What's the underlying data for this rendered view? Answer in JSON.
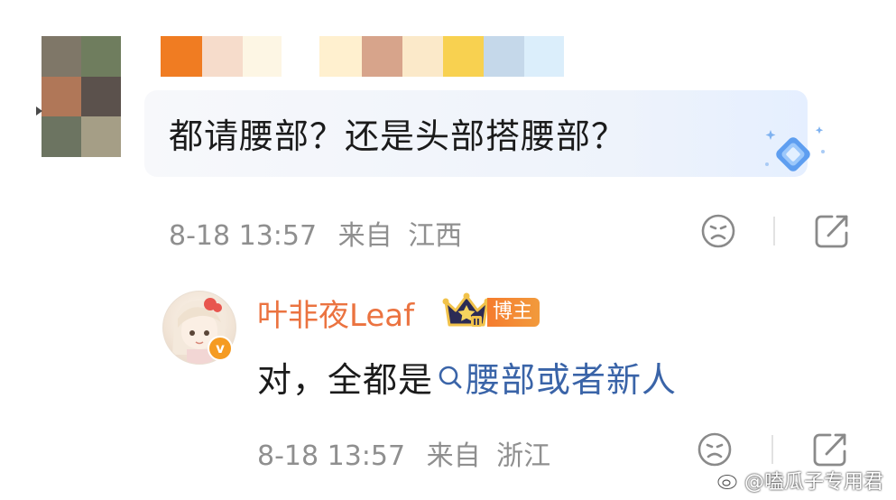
{
  "comment": {
    "mosaic_colors": [
      "#7f7768",
      "#6f7d5e",
      "#b07758",
      "#5b514c",
      "#6c7461",
      "#a59e86"
    ],
    "name_blocks": [
      "#f07c22",
      "#f6dccb",
      "#fdf6e4",
      "#ffffff",
      "#fff0cf",
      "#d7a48b",
      "#fbe9c9",
      "#f8d150",
      "#c5d8ea",
      "#dbeefb"
    ],
    "text": "都请腰部？还是头部搭腰部？",
    "date": "8-18 13:57",
    "source_prefix": "来自",
    "location": "江西"
  },
  "reply": {
    "name": "叶非夜Leaf",
    "badge": "博主",
    "verify_mark": "v",
    "text_prefix": "对，全都是",
    "link_text": "腰部或者新人",
    "date": "8-18 13:57",
    "source_prefix": "来自",
    "location": "浙江"
  },
  "watermark": "@嗑瓜子专用君",
  "colors": {
    "meta_gray": "#8f8f8f",
    "name_orange": "#eb7340",
    "link_blue": "#3a64a8",
    "badge_orange": "#f57c2e"
  },
  "icons": [
    "sad-face-icon",
    "share-icon",
    "search-icon",
    "crown-icon",
    "verified-icon",
    "gem-icon",
    "weibo-icon"
  ]
}
